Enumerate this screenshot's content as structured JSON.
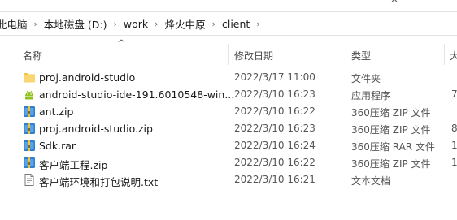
{
  "top_fragments": [
    "—",
    "×"
  ],
  "breadcrumb": [
    "此电脑",
    "本地磁盘 (D:)",
    "work",
    "烽火中原",
    "client"
  ],
  "columns": {
    "name": "名称",
    "modified": "修改日期",
    "type": "类型",
    "size": "大"
  },
  "files": [
    {
      "icon": "folder-icon",
      "name": "proj.android-studio",
      "modified": "2022/3/17 11:00",
      "type": "文件夹",
      "size": ""
    },
    {
      "icon": "android-app-icon",
      "name": "android-studio-ide-191.6010548-win...",
      "modified": "2022/3/10 16:23",
      "type": "应用程序",
      "size": "7"
    },
    {
      "icon": "zip-archive-icon",
      "name": "ant.zip",
      "modified": "2022/3/10 16:22",
      "type": "360压缩 ZIP 文件",
      "size": ""
    },
    {
      "icon": "zip-archive-icon",
      "name": "proj.android-studio.zip",
      "modified": "2022/3/10 16:23",
      "type": "360压缩 ZIP 文件",
      "size": "8"
    },
    {
      "icon": "rar-archive-icon",
      "name": "Sdk.rar",
      "modified": "2022/3/10 16:24",
      "type": "360压缩 RAR 文件",
      "size": "1"
    },
    {
      "icon": "zip-archive-icon",
      "name": "客户端工程.zip",
      "modified": "2022/3/10 16:22",
      "type": "360压缩 ZIP 文件",
      "size": "1"
    },
    {
      "icon": "text-document-icon",
      "name": "客户端环境和打包说明.txt",
      "modified": "2022/3/10 16:21",
      "type": "文本文档",
      "size": ""
    }
  ],
  "colors": {
    "folder": "#f4c542",
    "android": "#8fc21f",
    "archive": "#2d7fd3",
    "text_icon": "#7a7a7a"
  }
}
